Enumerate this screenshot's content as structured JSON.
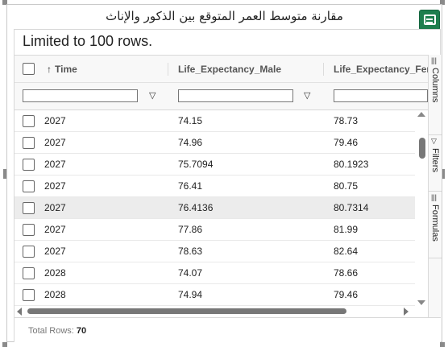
{
  "title": "مقارنة متوسط العمر المتوقع بين الذكور والإناث",
  "export_button_icon": "spreadsheet-export-icon",
  "limit_text": "Limited to 100 rows.",
  "columns": [
    {
      "label": "Time",
      "sort": "ascending",
      "sort_icon": "arrow-up-icon"
    },
    {
      "label": "Life_Expectancy_Male"
    },
    {
      "label": "Life_Expectancy_Fer"
    }
  ],
  "rows": [
    {
      "time": "2027",
      "male": "74.15",
      "female": "78.73"
    },
    {
      "time": "2027",
      "male": "74.96",
      "female": "79.46"
    },
    {
      "time": "2027",
      "male": "75.7094",
      "female": "80.1923"
    },
    {
      "time": "2027",
      "male": "76.41",
      "female": "80.75"
    },
    {
      "time": "2027",
      "male": "76.4136",
      "female": "80.7314"
    },
    {
      "time": "2027",
      "male": "77.86",
      "female": "81.99"
    },
    {
      "time": "2027",
      "male": "78.63",
      "female": "82.64"
    },
    {
      "time": "2028",
      "male": "74.07",
      "female": "78.66"
    },
    {
      "time": "2028",
      "male": "74.94",
      "female": "79.46"
    }
  ],
  "highlighted_row": 4,
  "side_tabs": [
    {
      "label": "Columns",
      "icon": "columns-icon"
    },
    {
      "label": "Filters",
      "icon": "filter-icon"
    },
    {
      "label": "Formulas",
      "icon": "formulas-icon"
    }
  ],
  "footer": {
    "label": "Total Rows:",
    "value": "70"
  },
  "colors": {
    "export_button": "#1e7e4e",
    "header_bg": "#f8f8f8",
    "highlight_row": "#ececec"
  }
}
